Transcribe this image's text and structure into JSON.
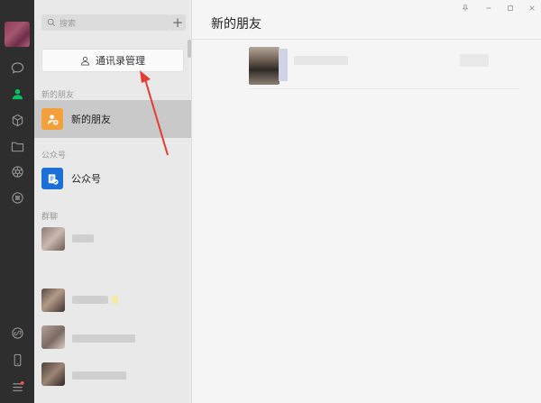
{
  "search": {
    "placeholder": "搜索"
  },
  "toolbar": {
    "add_label": "+"
  },
  "contacts_manager": {
    "label": "通讯录管理"
  },
  "sections": {
    "new_friends": "新的朋友",
    "official": "公众号",
    "groups": "群聊"
  },
  "items": {
    "new_friends": "新的朋友",
    "official": "公众号"
  },
  "main": {
    "title": "新的朋友"
  },
  "colors": {
    "accent": "#07c160",
    "annotation": "#e83a30",
    "rail": "#2e2e2e",
    "new_friend_icon": "#f3a03b",
    "official_icon": "#1d6fd8"
  }
}
